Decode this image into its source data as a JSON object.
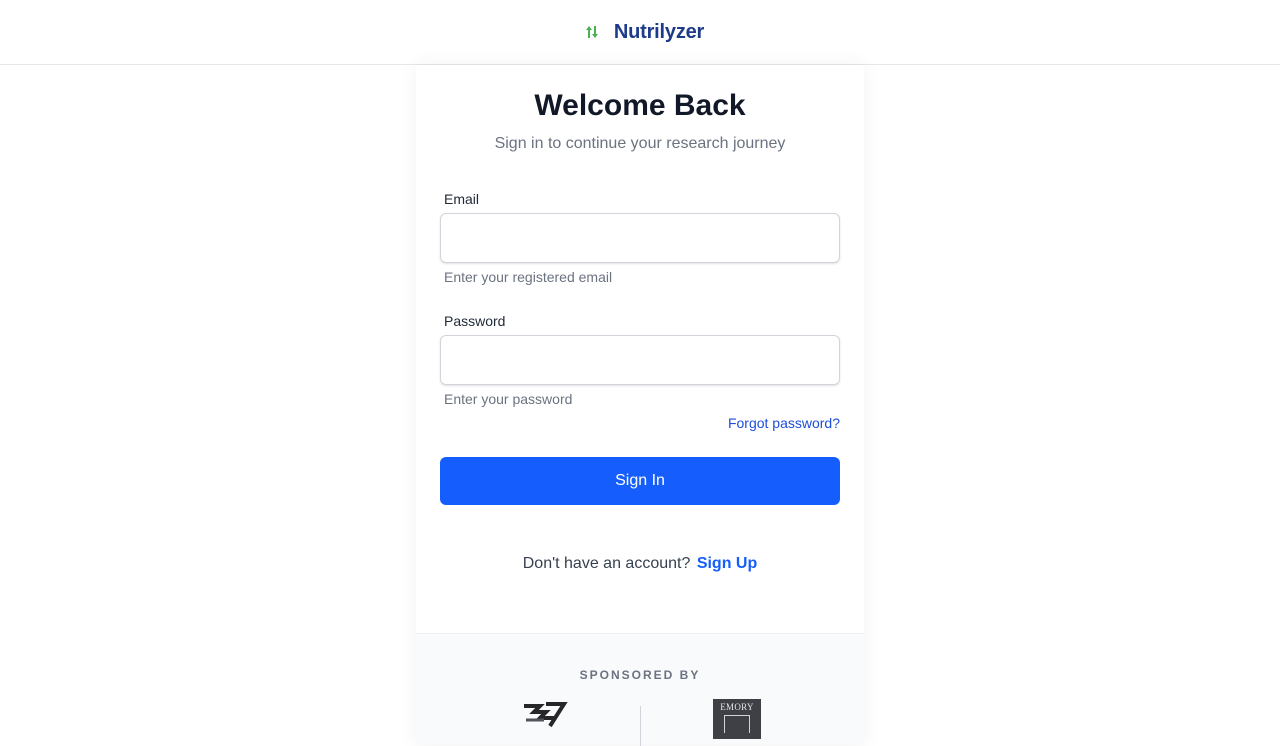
{
  "header": {
    "brand_name": "Nutrilyzer",
    "brand_icon": "leaf-arrows-icon",
    "brand_color": "#1e3a8a",
    "icon_color": "#4caf50"
  },
  "login": {
    "title": "Welcome Back",
    "subtitle": "Sign in to continue your research journey",
    "email": {
      "label": "Email",
      "value": "",
      "hint": "Enter your registered email"
    },
    "password": {
      "label": "Password",
      "value": "",
      "hint": "Enter your password"
    },
    "forgot_label": "Forgot password?",
    "submit_label": "Sign In",
    "signup_prompt": "Don't have an account?",
    "signup_label": "Sign Up",
    "accent_color": "#155dfc"
  },
  "sponsors": {
    "title": "SPONSORED BY",
    "logos": [
      {
        "name": "sponsor-logo-1",
        "icon": "emblem-icon"
      },
      {
        "name": "sponsor-logo-emory",
        "text": "EMORY"
      }
    ]
  }
}
